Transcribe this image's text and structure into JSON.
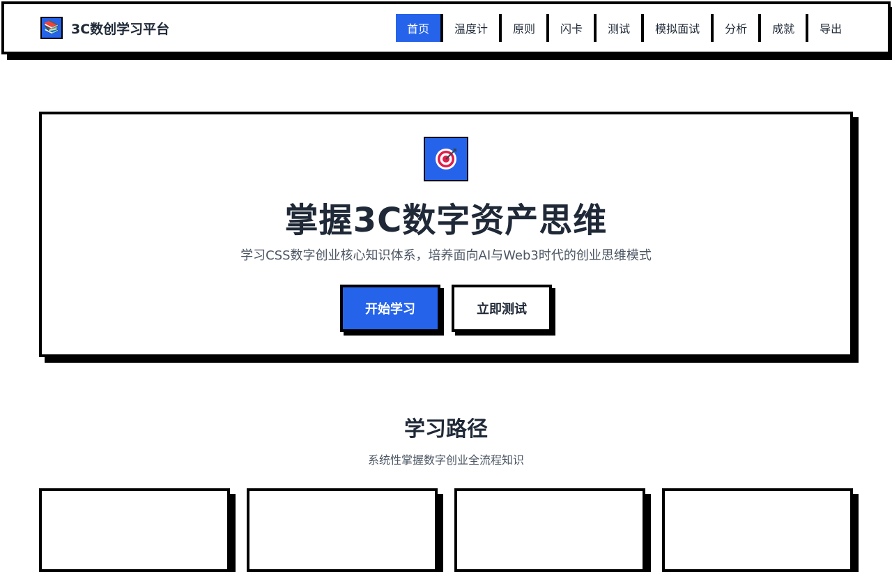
{
  "brand": {
    "icon": "books-icon",
    "icon_glyph": "📚",
    "title": "3C数创学习平台"
  },
  "nav": {
    "items": [
      {
        "label": "首页",
        "active": true
      },
      {
        "label": "温度计",
        "active": false
      },
      {
        "label": "原则",
        "active": false
      },
      {
        "label": "闪卡",
        "active": false
      },
      {
        "label": "测试",
        "active": false
      },
      {
        "label": "模拟面试",
        "active": false
      },
      {
        "label": "分析",
        "active": false
      },
      {
        "label": "成就",
        "active": false
      },
      {
        "label": "导出",
        "active": false
      }
    ]
  },
  "hero": {
    "icon": "target-icon",
    "title": "掌握3C数字资产思维",
    "subtitle": "学习CSS数字创业核心知识体系，培养面向AI与Web3时代的创业思维模式",
    "primary_button": "开始学习",
    "secondary_button": "立即测试"
  },
  "path_section": {
    "title": "学习路径",
    "subtitle": "系统性掌握数字创业全流程知识"
  },
  "colors": {
    "accent": "#2563eb",
    "border": "#000000",
    "text": "#1f2937",
    "muted": "#4b5563"
  }
}
